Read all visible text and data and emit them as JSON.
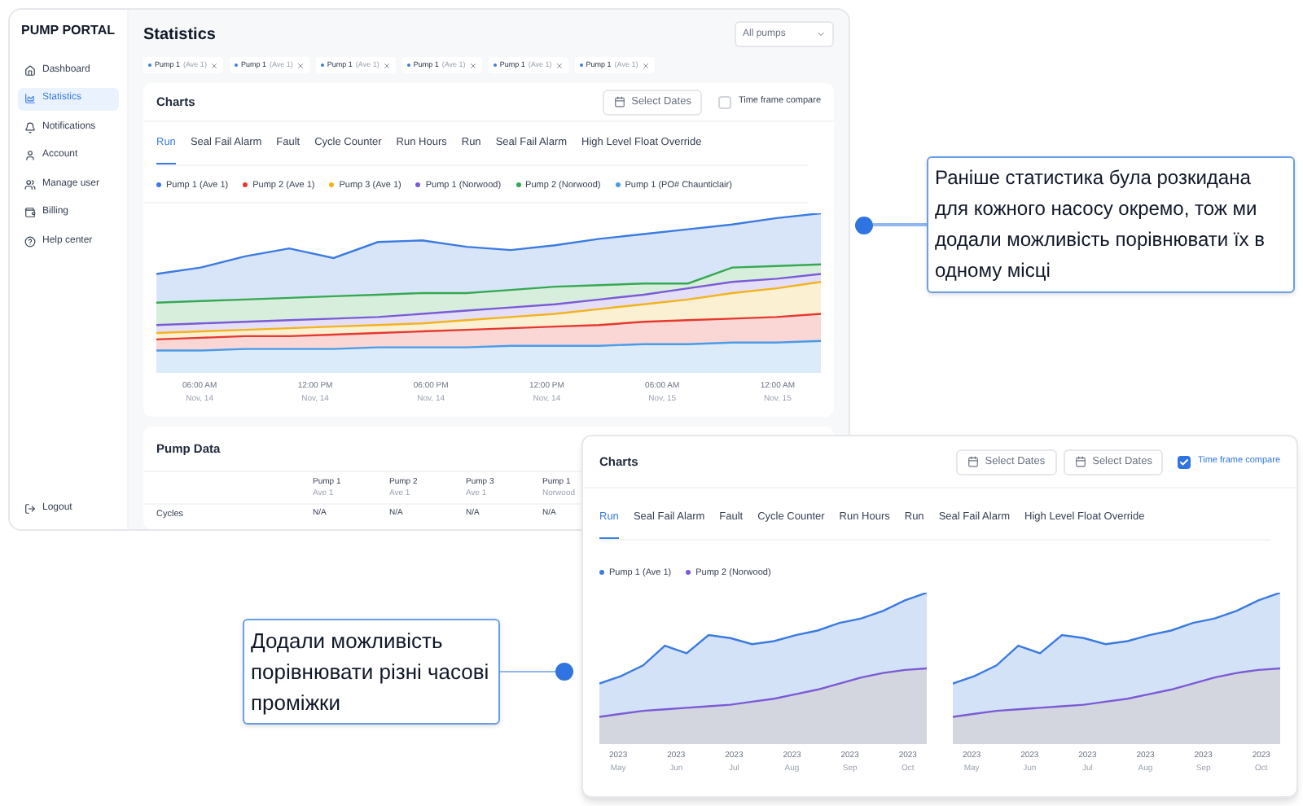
{
  "app": {
    "logo": "PUMP PORTAL",
    "sidebar": {
      "items": [
        {
          "label": "Dashboard",
          "selected": false
        },
        {
          "label": "Statistics",
          "selected": true
        },
        {
          "label": "Notifications",
          "selected": false
        },
        {
          "label": "Account",
          "selected": false
        },
        {
          "label": "Manage user",
          "selected": false
        },
        {
          "label": "Billing",
          "selected": false
        },
        {
          "label": "Help center",
          "selected": false
        }
      ],
      "logout": "Logout"
    },
    "title": "Statistics",
    "pump_select": {
      "value": "All pumps"
    },
    "filter_chips": [
      {
        "name": "Pump 1",
        "site": "(Ave 1)"
      },
      {
        "name": "Pump 1",
        "site": "(Ave 1)"
      },
      {
        "name": "Pump 1",
        "site": "(Ave 1)"
      },
      {
        "name": "Pump 1",
        "site": "(Ave 1)"
      },
      {
        "name": "Pump 1",
        "site": "(Ave 1)"
      },
      {
        "name": "Pump 1",
        "site": "(Ave 1)"
      }
    ],
    "charts_card": {
      "title": "Charts",
      "date_button": "Select Dates",
      "compare": {
        "label": "Time frame compare",
        "checked": false
      },
      "tabs": [
        {
          "label": "Run",
          "selected": true
        },
        {
          "label": "Seal Fail Alarm",
          "selected": false
        },
        {
          "label": "Fault",
          "selected": false
        },
        {
          "label": "Cycle Counter",
          "selected": false
        },
        {
          "label": "Run Hours",
          "selected": false
        },
        {
          "label": "Run",
          "selected": false
        },
        {
          "label": "Seal Fail Alarm",
          "selected": false
        },
        {
          "label": "High Level Float Override",
          "selected": false
        }
      ],
      "legend": [
        {
          "label": "Pump 1 (Ave 1)",
          "color": "#3b7be0"
        },
        {
          "label": "Pump 2 (Ave 1)",
          "color": "#e5382f"
        },
        {
          "label": "Pump 3 (Ave 1)",
          "color": "#f2b31d"
        },
        {
          "label": "Pump 1 (Norwood)",
          "color": "#7a5bd6"
        },
        {
          "label": "Pump 2 (Norwood)",
          "color": "#36a852"
        },
        {
          "label": "Pump 1 (PO# Chaunticlair)",
          "color": "#4a9be8"
        }
      ],
      "x_labels": [
        {
          "time": "06:00 AM",
          "date": "Nov, 14"
        },
        {
          "time": "12:00 PM",
          "date": "Nov, 14"
        },
        {
          "time": "06:00 PM",
          "date": "Nov, 14"
        },
        {
          "time": "12:00 PM",
          "date": "Nov, 14"
        },
        {
          "time": "06:00 AM",
          "date": "Nov, 15"
        },
        {
          "time": "12:00 AM",
          "date": "Nov, 15"
        }
      ]
    },
    "pump_data": {
      "title": "Pump Data",
      "columns": [
        {
          "name": "Pump 1",
          "site": "Ave 1"
        },
        {
          "name": "Pump 2",
          "site": "Ave 1"
        },
        {
          "name": "Pump 3",
          "site": "Ave 1"
        },
        {
          "name": "Pump 1",
          "site": "Norwood"
        }
      ],
      "rows": [
        {
          "label": "Cycles",
          "cells": [
            "N/A",
            "N/A",
            "N/A",
            "N/A"
          ]
        }
      ]
    }
  },
  "compare_panel": {
    "title": "Charts",
    "date_buttons": [
      "Select Dates",
      "Select Dates"
    ],
    "compare": {
      "label": "Time frame compare",
      "checked": true
    },
    "tabs": [
      {
        "label": "Run",
        "selected": true
      },
      {
        "label": "Seal Fail Alarm",
        "selected": false
      },
      {
        "label": "Fault",
        "selected": false
      },
      {
        "label": "Cycle Counter",
        "selected": false
      },
      {
        "label": "Run Hours",
        "selected": false
      },
      {
        "label": "Run",
        "selected": false
      },
      {
        "label": "Seal Fail Alarm",
        "selected": false
      },
      {
        "label": "High Level Float Override",
        "selected": false
      }
    ],
    "legend": [
      {
        "label": "Pump 1 (Ave 1)",
        "color": "#3b7be0"
      },
      {
        "label": "Pump 2 (Norwood)",
        "color": "#7a5bd6"
      }
    ],
    "charts": [
      {
        "x_labels": [
          {
            "year": "2023",
            "month": "May"
          },
          {
            "year": "2023",
            "month": "Jun"
          },
          {
            "year": "2023",
            "month": "Jul"
          },
          {
            "year": "2023",
            "month": "Aug"
          },
          {
            "year": "2023",
            "month": "Sep"
          },
          {
            "year": "2023",
            "month": "Oct"
          }
        ]
      },
      {
        "x_labels": [
          {
            "year": "2023",
            "month": "May"
          },
          {
            "year": "2023",
            "month": "Jun"
          },
          {
            "year": "2023",
            "month": "Jul"
          },
          {
            "year": "2023",
            "month": "Aug"
          },
          {
            "year": "2023",
            "month": "Sep"
          },
          {
            "year": "2023",
            "month": "Oct"
          }
        ]
      }
    ]
  },
  "callouts": [
    {
      "text": "Раніше статистика була розкидана для кожного насосу окремо, тож ми додали можливість порівнювати їх в одному місці"
    },
    {
      "text": "Додали можливість порівнювати різні часові проміжки"
    }
  ]
}
